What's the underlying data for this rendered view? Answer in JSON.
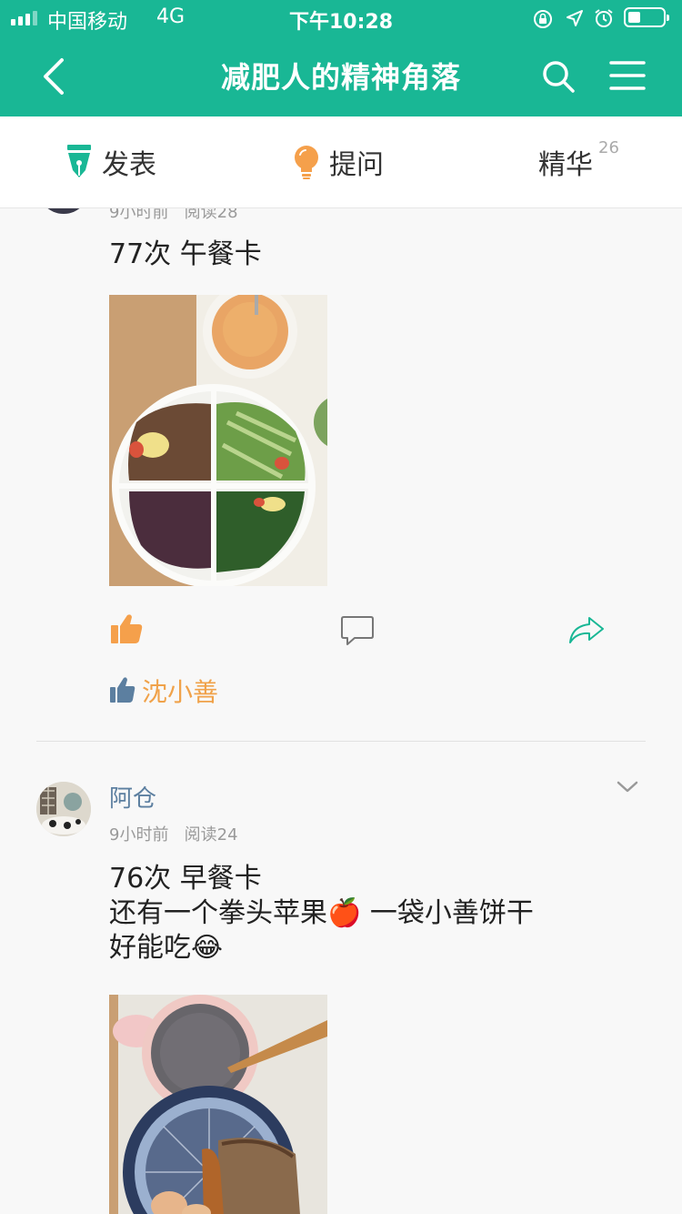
{
  "status_bar": {
    "carrier": "中国移动",
    "network": "4G",
    "time": "下午10:28",
    "signal_bars_filled": 3,
    "battery_level": 0.35
  },
  "header": {
    "title": "减肥人的精神角落",
    "back_icon": "chevron-left-icon",
    "search_icon": "search-icon",
    "menu_icon": "hamburger-menu-icon",
    "background_color": "#19b795"
  },
  "tabs": {
    "post_label": "发表",
    "ask_label": "提问",
    "featured_label": "精华",
    "featured_count": "26"
  },
  "posts": [
    {
      "meta_time": "9小时前",
      "meta_reads": "阅读28",
      "text": "77次 午餐卡",
      "liker_name": "沈小善",
      "like_color": "#f5a04b",
      "share_color": "#19b795"
    },
    {
      "author": "阿仓",
      "meta_time": "9小时前",
      "meta_reads": "阅读24",
      "text_line1": "76次 早餐卡",
      "text_line2": "还有一个拳头苹果🍎 一袋小善饼干",
      "text_line3": "好能吃😂"
    }
  ]
}
